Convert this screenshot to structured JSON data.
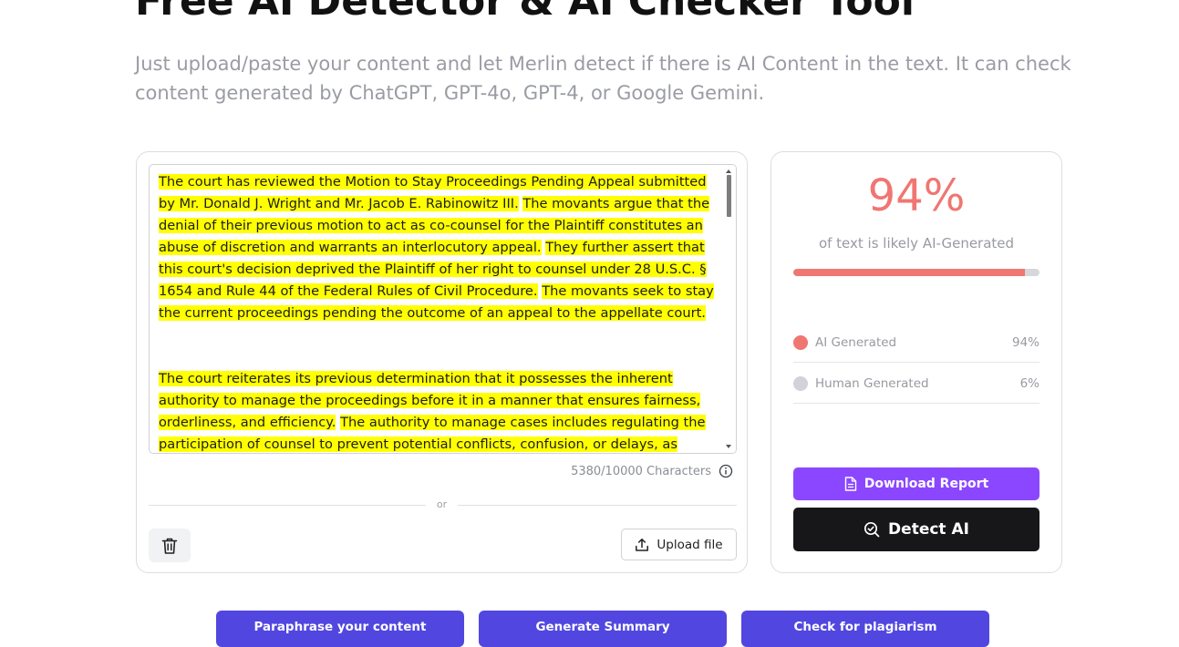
{
  "hero": {
    "title": "Free AI Detector & AI Checker Tool",
    "subtitle": "Just upload/paste your content and let Merlin detect if there is AI Content in the text. It can check content generated by ChatGPT, GPT-4o, GPT-4, or Google Gemini."
  },
  "editor": {
    "paragraphs": [
      {
        "sentences": [
          "The court has reviewed the Motion to Stay Proceedings Pending Appeal submitted by Mr. Donald J. Wright and Mr. Jacob E. Rabinowitz III.",
          "The movants argue that the denial of their previous motion to act as co-counsel for the Plaintiff constitutes an abuse of discretion and warrants an interlocutory appeal.",
          "They further assert that this court's decision deprived the Plaintiff of her right to counsel under 28 U.S.C. § 1654 and Rule 44 of the Federal Rules of Civil Procedure.",
          "The movants seek to stay the current proceedings pending the outcome of an appeal to the appellate court."
        ]
      },
      {
        "sentences": [
          "The court reiterates its previous determination that it possesses the inherent authority to manage the proceedings before it in a manner that ensures fairness, orderliness, and efficiency.",
          "The authority to manage cases includes regulating the participation of counsel to prevent potential conflicts, confusion, or delays, as"
        ]
      }
    ],
    "char_count": "5380/10000 Characters",
    "divider_text": "or",
    "upload_label": "Upload file",
    "icons": {
      "info": "info-icon",
      "trash": "trash-icon",
      "upload": "upload-icon"
    }
  },
  "result": {
    "percent_text": "94%",
    "percent_value": 94,
    "caption": "of text is likely AI-Generated",
    "legend": [
      {
        "label": "AI Generated",
        "value": "94%",
        "color": "#f07672"
      },
      {
        "label": "Human Generated",
        "value": "6%",
        "color": "#d1d3d8"
      }
    ],
    "download_label": "Download Report",
    "detect_label": "Detect AI",
    "accent": "#f07672"
  },
  "actions": [
    {
      "label": "Paraphrase your content"
    },
    {
      "label": "Generate Summary"
    },
    {
      "label": "Check for plagiarism"
    }
  ],
  "colors": {
    "highlight": "#ffff00",
    "download": "#8b47ff",
    "detect": "#17171a",
    "action": "#5147e0"
  }
}
